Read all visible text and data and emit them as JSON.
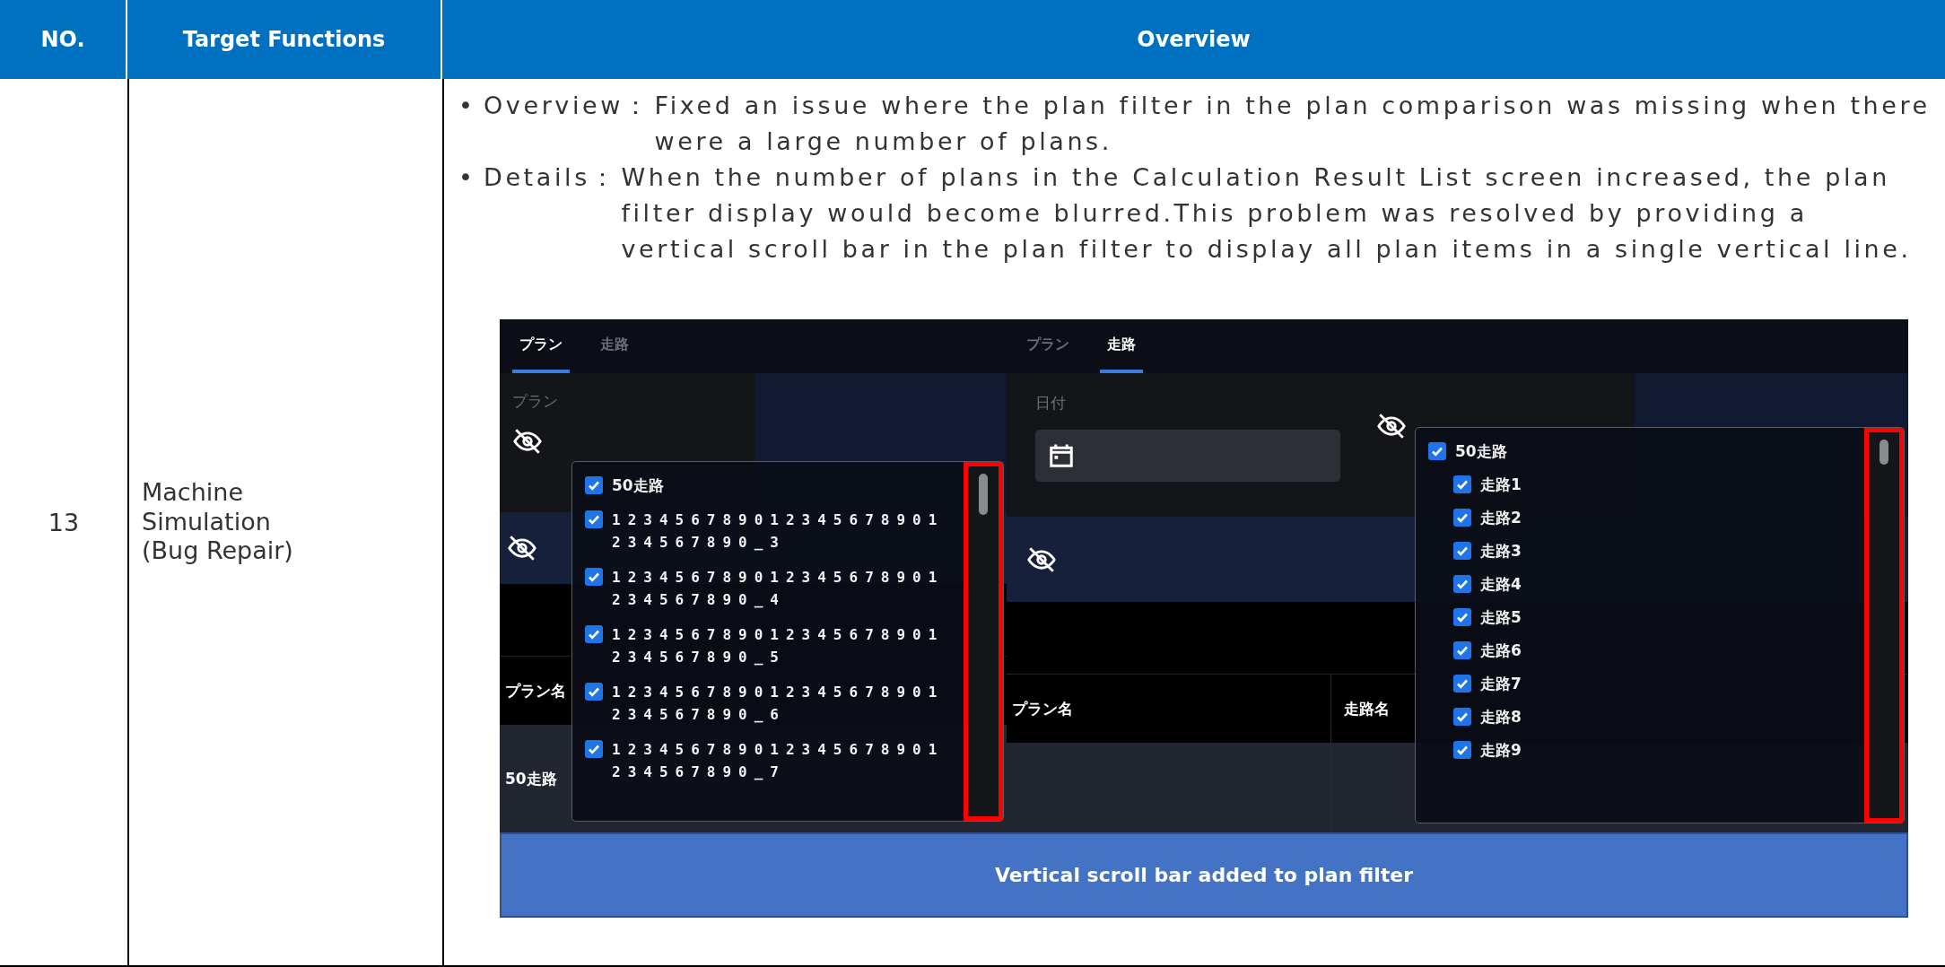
{
  "table": {
    "columns": [
      "NO.",
      "Target Functions",
      "Overview"
    ],
    "rows": [
      {
        "no": "13",
        "target": "Machine\nSimulation\n(Bug Repair)",
        "bullets": [
          {
            "bullet": "•",
            "label": "Overview：",
            "text": "Fixed an issue where the plan filter in the plan comparison was missing when there were a large number of plans."
          },
          {
            "bullet": "•",
            "label": "Details：",
            "text": "When the number of plans in the Calculation Result List screen increased, the plan filter display would become blurred.This problem was resolved by providing a vertical scroll bar in the plan filter to display all plan items in a single vertical line."
          }
        ],
        "screenshots": [
          {
            "kind": "plan",
            "tabs": [
              {
                "label": "プラン",
                "selected": true
              },
              {
                "label": "走路",
                "selected": false
              }
            ],
            "filter_label": "プラン",
            "table_header": [
              "プラン名"
            ],
            "table_row": [
              "50走路"
            ],
            "popup": {
              "items": [
                {
                  "kind": "group",
                  "label": "50走路",
                  "checked": true
                },
                {
                  "kind": "plan",
                  "label": "123456789012345678901234567890_3",
                  "checked": true
                },
                {
                  "kind": "plan",
                  "label": "123456789012345678901234567890_4",
                  "checked": true
                },
                {
                  "kind": "plan",
                  "label": "123456789012345678901234567890_5",
                  "checked": true
                },
                {
                  "kind": "plan",
                  "label": "123456789012345678901234567890_6",
                  "checked": true
                },
                {
                  "kind": "plan",
                  "label": "123456789012345678901234567890_7",
                  "checked": true
                }
              ]
            }
          },
          {
            "kind": "runway",
            "tabs": [
              {
                "label": "プラン",
                "selected": false
              },
              {
                "label": "走路",
                "selected": true
              }
            ],
            "date_label": "日付",
            "table_header": [
              "プラン名",
              "走路名"
            ],
            "popup": {
              "items": [
                {
                  "label": "50走路",
                  "checked": true,
                  "children": [
                    {
                      "label": "走路1",
                      "checked": true
                    },
                    {
                      "label": "走路2",
                      "checked": true
                    },
                    {
                      "label": "走路3",
                      "checked": true
                    },
                    {
                      "label": "走路4",
                      "checked": true
                    },
                    {
                      "label": "走路5",
                      "checked": true
                    },
                    {
                      "label": "走路6",
                      "checked": true
                    },
                    {
                      "label": "走路7",
                      "checked": true
                    },
                    {
                      "label": "走路8",
                      "checked": true
                    },
                    {
                      "label": "走路9",
                      "checked": true
                    }
                  ]
                }
              ]
            }
          }
        ],
        "caption": "Vertical scroll bar added to plan filter"
      }
    ]
  }
}
